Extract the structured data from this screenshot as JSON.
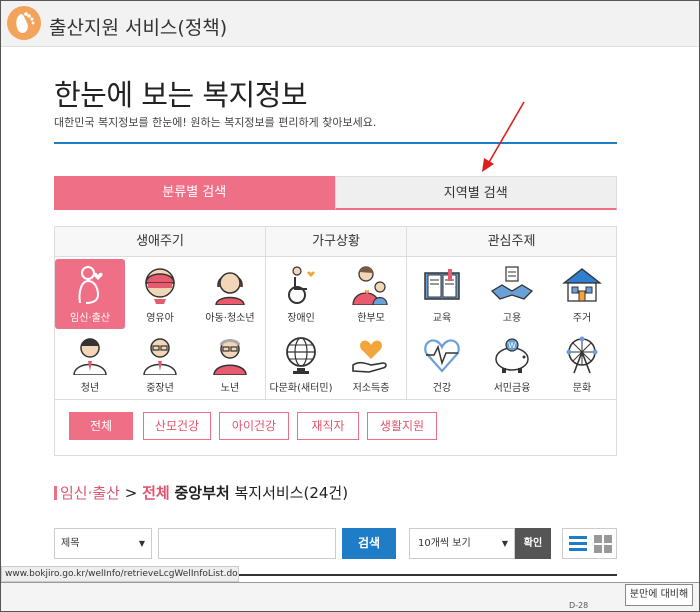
{
  "window": {
    "title": "출산지원 서비스(정책)"
  },
  "page": {
    "title": "한눈에 보는 복지정보",
    "subtitle": "대한민국 복지정보를 한눈에! 원하는 복지정보를 편리하게 찾아보세요."
  },
  "tabs": [
    {
      "label": "분류별 검색",
      "active": true
    },
    {
      "label": "지역별 검색",
      "active": false
    }
  ],
  "categories": {
    "groups": [
      {
        "title": "생애주기"
      },
      {
        "title": "가구상황"
      },
      {
        "title": "관심주제"
      }
    ],
    "items": [
      {
        "label": "임신·출산",
        "icon": "pregnant-woman-icon",
        "selected": true
      },
      {
        "label": "영유아",
        "icon": "infant-icon"
      },
      {
        "label": "아동·청소년",
        "icon": "child-teen-icon"
      },
      {
        "label": "청년",
        "icon": "young-man-icon"
      },
      {
        "label": "중장년",
        "icon": "middle-aged-icon"
      },
      {
        "label": "노년",
        "icon": "elderly-icon"
      },
      {
        "label": "장애인",
        "icon": "wheelchair-icon"
      },
      {
        "label": "한부모",
        "icon": "single-parent-icon"
      },
      {
        "label": "다문화(새터민)",
        "icon": "globe-icon"
      },
      {
        "label": "저소득층",
        "icon": "heart-hand-icon"
      },
      {
        "label": "교육",
        "icon": "book-icon"
      },
      {
        "label": "고용",
        "icon": "handshake-icon"
      },
      {
        "label": "주거",
        "icon": "house-icon"
      },
      {
        "label": "건강",
        "icon": "health-heart-icon"
      },
      {
        "label": "서민금융",
        "icon": "piggy-bank-icon"
      },
      {
        "label": "문화",
        "icon": "ferris-wheel-icon"
      }
    ]
  },
  "subtabs": [
    {
      "label": "전체",
      "active": true
    },
    {
      "label": "산모건강"
    },
    {
      "label": "아이건강"
    },
    {
      "label": "재직자"
    },
    {
      "label": "생활지원"
    }
  ],
  "results": {
    "category": "임신·출산",
    "separator": ">",
    "filter": "전체",
    "dept": "중앙부처",
    "suffix": "복지서비스(24건)"
  },
  "search": {
    "field_select": "제목",
    "keyword": "",
    "button": "검색",
    "page_size": "10개씩 보기",
    "confirm": "확인"
  },
  "status": {
    "url": "www.bokjiro.go.kr/welInfo/retrieveLcgWelInfoList.do"
  },
  "taskbar": {
    "title": "분만에 대비해",
    "code": "D-28"
  },
  "colors": {
    "accent": "#ef6f86",
    "primary": "#1f7dc8",
    "annotation": "#e01e1e"
  }
}
